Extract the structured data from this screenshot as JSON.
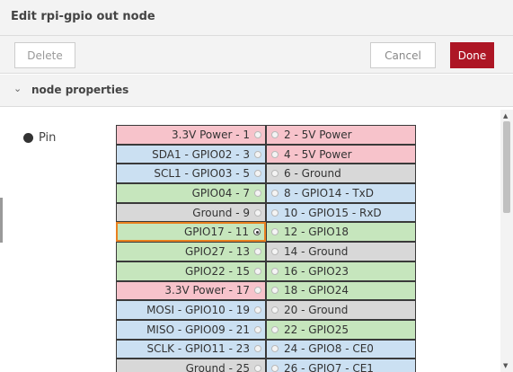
{
  "dialog": {
    "title": "Edit rpi-gpio out node",
    "delete_label": "Delete",
    "cancel_label": "Cancel",
    "done_label": "Done",
    "accent": "#ad1625"
  },
  "section": {
    "chevron": "chevron-down-icon",
    "title": "node properties"
  },
  "pin_label": "Pin",
  "colors": {
    "power": "#f7c3cb",
    "i2c_spi_uart": "#cbe0f2",
    "ground": "#d8d8d8",
    "gpio": "#c6e6bd",
    "selected_outline": "#e9801f"
  },
  "pins": [
    {
      "left": {
        "label": "3.3V Power - 1",
        "type": "power"
      },
      "right": {
        "label": "2 - 5V Power",
        "type": "power"
      }
    },
    {
      "left": {
        "label": "SDA1 - GPIO02 - 3",
        "type": "i2c"
      },
      "right": {
        "label": "4 - 5V Power",
        "type": "power"
      }
    },
    {
      "left": {
        "label": "SCL1 - GPIO03 - 5",
        "type": "i2c"
      },
      "right": {
        "label": "6 - Ground",
        "type": "ground"
      }
    },
    {
      "left": {
        "label": "GPIO04 - 7",
        "type": "gpio"
      },
      "right": {
        "label": "8 - GPIO14 - TxD",
        "type": "i2c"
      }
    },
    {
      "left": {
        "label": "Ground - 9",
        "type": "ground"
      },
      "right": {
        "label": "10 - GPIO15 - RxD",
        "type": "i2c"
      }
    },
    {
      "left": {
        "label": "GPIO17 - 11",
        "type": "gpio",
        "selected": true
      },
      "right": {
        "label": "12 - GPIO18",
        "type": "gpio"
      }
    },
    {
      "left": {
        "label": "GPIO27 - 13",
        "type": "gpio"
      },
      "right": {
        "label": "14 - Ground",
        "type": "ground"
      }
    },
    {
      "left": {
        "label": "GPIO22 - 15",
        "type": "gpio"
      },
      "right": {
        "label": "16 - GPIO23",
        "type": "gpio"
      }
    },
    {
      "left": {
        "label": "3.3V Power - 17",
        "type": "power"
      },
      "right": {
        "label": "18 - GPIO24",
        "type": "gpio"
      }
    },
    {
      "left": {
        "label": "MOSI - GPIO10 - 19",
        "type": "i2c"
      },
      "right": {
        "label": "20 - Ground",
        "type": "ground"
      }
    },
    {
      "left": {
        "label": "MISO - GPIO09 - 21",
        "type": "i2c"
      },
      "right": {
        "label": "22 - GPIO25",
        "type": "gpio"
      }
    },
    {
      "left": {
        "label": "SCLK - GPIO11 - 23",
        "type": "i2c"
      },
      "right": {
        "label": "24 - GPIO8 - CE0",
        "type": "i2c"
      }
    },
    {
      "left": {
        "label": "Ground - 25",
        "type": "ground"
      },
      "right": {
        "label": "26 - GPIO7 - CE1",
        "type": "i2c"
      }
    }
  ]
}
